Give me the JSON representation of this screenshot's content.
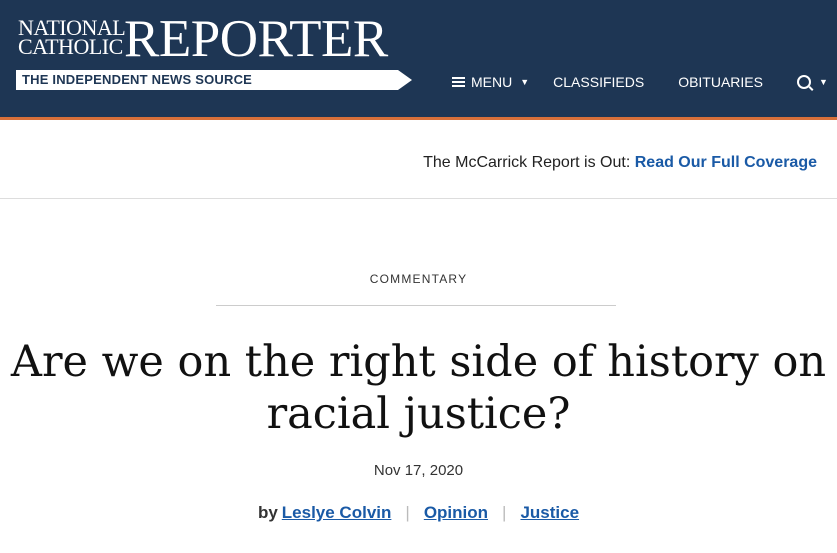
{
  "header": {
    "logo_small_line1": "NATIONAL",
    "logo_small_line2": "CATHOLIC",
    "logo_big": "REPORTER",
    "tagline": "THE INDEPENDENT NEWS SOURCE",
    "nav": {
      "menu": "MENU",
      "classifieds": "CLASSIFIEDS",
      "obituaries": "OBITUARIES"
    },
    "colors": {
      "background": "#1e3654",
      "accent_border": "#d8703a"
    }
  },
  "promo": {
    "text": "The McCarrick Report is Out:",
    "link": "Read Our Full Coverage"
  },
  "article": {
    "kicker": "COMMENTARY",
    "headline": "Are we on the right side of history on racial justice?",
    "date": "Nov 17, 2020",
    "by_label": "by",
    "author": "Leslye Colvin",
    "section": "Opinion",
    "topic": "Justice",
    "link_color": "#1a5aa6"
  },
  "icons": [
    "hamburger-icon",
    "chevron-down-icon",
    "search-icon"
  ]
}
